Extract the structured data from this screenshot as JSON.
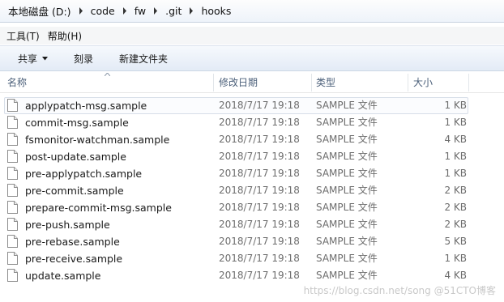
{
  "breadcrumb": {
    "segments": [
      "本地磁盘 (D:)",
      "code",
      "fw",
      ".git",
      "hooks"
    ]
  },
  "menu": {
    "items": [
      "工具(T)",
      "帮助(H)"
    ]
  },
  "toolbar": {
    "share_label": "共享",
    "burn_label": "刻录",
    "new_folder_label": "新建文件夹"
  },
  "columns": {
    "name": "名称",
    "date": "修改日期",
    "type": "类型",
    "size": "大小"
  },
  "files": [
    {
      "name": "applypatch-msg.sample",
      "date": "2018/7/17 19:18",
      "type": "SAMPLE 文件",
      "size": "1 KB"
    },
    {
      "name": "commit-msg.sample",
      "date": "2018/7/17 19:18",
      "type": "SAMPLE 文件",
      "size": "1 KB"
    },
    {
      "name": "fsmonitor-watchman.sample",
      "date": "2018/7/17 19:18",
      "type": "SAMPLE 文件",
      "size": "4 KB"
    },
    {
      "name": "post-update.sample",
      "date": "2018/7/17 19:18",
      "type": "SAMPLE 文件",
      "size": "1 KB"
    },
    {
      "name": "pre-applypatch.sample",
      "date": "2018/7/17 19:18",
      "type": "SAMPLE 文件",
      "size": "1 KB"
    },
    {
      "name": "pre-commit.sample",
      "date": "2018/7/17 19:18",
      "type": "SAMPLE 文件",
      "size": "2 KB"
    },
    {
      "name": "prepare-commit-msg.sample",
      "date": "2018/7/17 19:18",
      "type": "SAMPLE 文件",
      "size": "2 KB"
    },
    {
      "name": "pre-push.sample",
      "date": "2018/7/17 19:18",
      "type": "SAMPLE 文件",
      "size": "2 KB"
    },
    {
      "name": "pre-rebase.sample",
      "date": "2018/7/17 19:18",
      "type": "SAMPLE 文件",
      "size": "5 KB"
    },
    {
      "name": "pre-receive.sample",
      "date": "2018/7/17 19:18",
      "type": "SAMPLE 文件",
      "size": "1 KB"
    },
    {
      "name": "update.sample",
      "date": "2018/7/17 19:18",
      "type": "SAMPLE 文件",
      "size": "4 KB"
    }
  ],
  "watermark": "https://blog.csdn.net/song @51CTO博客",
  "colors": {
    "header_text": "#4c607a",
    "detail_text": "#6d6d6d",
    "toolbar_top": "#f6f9fd",
    "toolbar_bottom": "#e3ebf6"
  }
}
